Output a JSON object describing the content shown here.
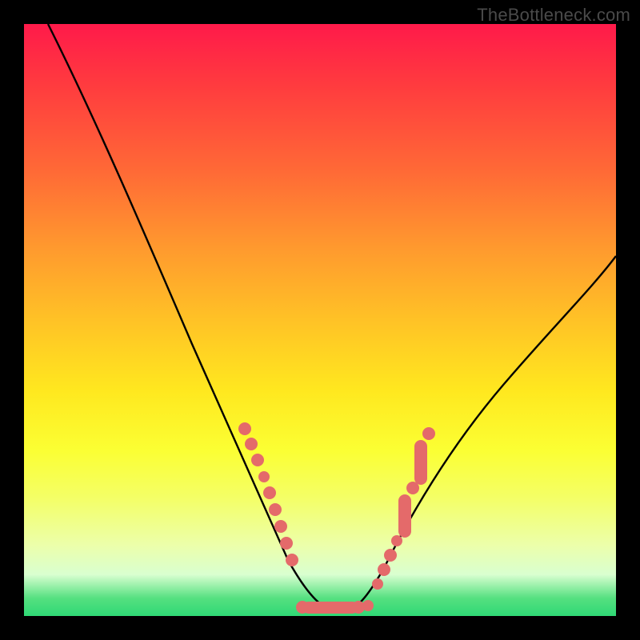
{
  "watermark": "TheBottleneck.com",
  "chart_data": {
    "type": "line",
    "title": "",
    "xlabel": "",
    "ylabel": "",
    "xlim": [
      0,
      100
    ],
    "ylim": [
      0,
      100
    ],
    "series": [
      {
        "name": "bottleneck-curve",
        "x": [
          4,
          10,
          15,
          20,
          25,
          30,
          34,
          37,
          40,
          42,
          44,
          46,
          48,
          50,
          52,
          54,
          56,
          58,
          61,
          65,
          70,
          76,
          82,
          88,
          94,
          100
        ],
        "values": [
          100,
          88,
          78,
          68,
          57,
          47,
          38,
          31,
          24,
          19,
          14,
          9,
          5,
          2,
          1,
          1,
          2,
          4,
          8,
          14,
          22,
          31,
          40,
          48,
          55,
          62
        ]
      }
    ],
    "markers": {
      "left_cluster": {
        "x": [
          37,
          39,
          40,
          41,
          42,
          43,
          44,
          45
        ],
        "y": [
          32,
          27,
          24,
          22,
          19,
          16,
          13,
          10
        ]
      },
      "right_cluster": {
        "x": [
          57,
          58,
          59,
          60,
          61,
          62,
          63,
          64,
          65
        ],
        "y": [
          4,
          6,
          8,
          10,
          12,
          14,
          17,
          20,
          23
        ]
      },
      "bottom_bar": {
        "x_start": 47,
        "x_end": 55,
        "y": 1
      }
    },
    "marker_color": "#e46a6a",
    "curve_color": "#000000"
  }
}
